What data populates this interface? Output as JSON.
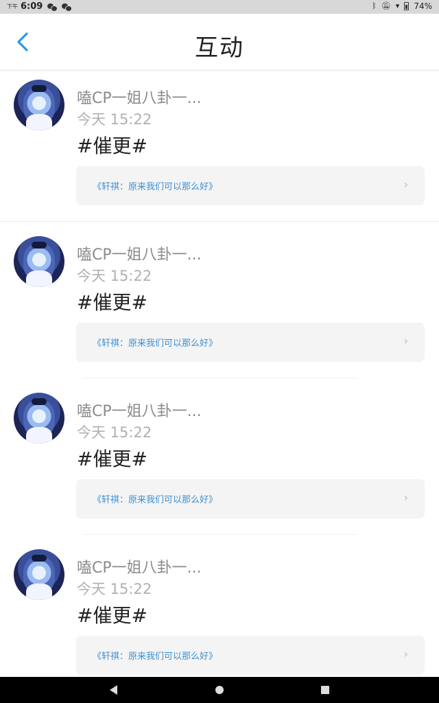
{
  "status_bar": {
    "ampm": "下午",
    "time": "6:09",
    "battery": "74%",
    "icons": [
      "wechat-icon",
      "wechat-icon",
      "bluetooth-icon",
      "mute-icon",
      "wifi-icon",
      "battery-icon"
    ]
  },
  "header": {
    "title": "互动",
    "back_icon": "chevron-left-icon"
  },
  "colors": {
    "accent": "#2a98e0",
    "link": "#3e8fd0",
    "username": "#8a8a8a",
    "timestamp": "#b0b0b0",
    "card_bg": "#f4f4f4"
  },
  "feed": {
    "items": [
      {
        "username": "嗑CP一姐八卦一...",
        "time": "今天 15:22",
        "content": "#催更#",
        "quote": "《轩祺：原来我们可以那么好》"
      },
      {
        "username": "嗑CP一姐八卦一...",
        "time": "今天 15:22",
        "content": "#催更#",
        "quote": "《轩祺：原来我们可以那么好》"
      },
      {
        "username": "嗑CP一姐八卦一...",
        "time": "今天 15:22",
        "content": "#催更#",
        "quote": "《轩祺：原来我们可以那么好》"
      },
      {
        "username": "嗑CP一姐八卦一...",
        "time": "今天 15:22",
        "content": "#催更#",
        "quote": "《轩祺：原来我们可以那么好》"
      }
    ]
  },
  "quote_chevron": "›"
}
